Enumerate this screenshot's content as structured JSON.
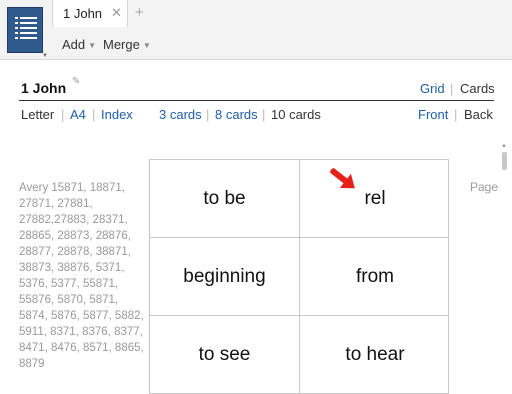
{
  "toolbar": {
    "app_icon": "list-icon",
    "tab_label": "1 John",
    "tab_close": "✕",
    "tab_add": "+",
    "add_label": "Add",
    "merge_label": "Merge"
  },
  "header": {
    "title": "1 John",
    "grid_label": "Grid",
    "cards_label": "Cards",
    "separator": "|"
  },
  "options": {
    "letter": "Letter",
    "a4": "A4",
    "index": "Index",
    "cards3": "3 cards",
    "cards8": "8 cards",
    "cards10": "10 cards",
    "front": "Front",
    "back": "Back"
  },
  "sidebar": {
    "avery_text": "Avery 15871, 18871, 27871, 27881, 27882,27883, 28371, 28865, 28873, 28876, 28877, 28878, 38871, 38873, 38876, 5371, 5376, 5377, 55871, 55876, 5870, 5871, 5874, 5876, 5877, 5882, 5911, 8371, 8376, 8377, 8471, 8476, 8571, 8865, 8879"
  },
  "cards": [
    "to be",
    "rel",
    "beginning",
    "from",
    "to see",
    "to hear"
  ],
  "page_label": "Page",
  "colors": {
    "link": "#1e5fa8",
    "app_button": "#2f5a8c",
    "arrow": "#e8201a"
  }
}
